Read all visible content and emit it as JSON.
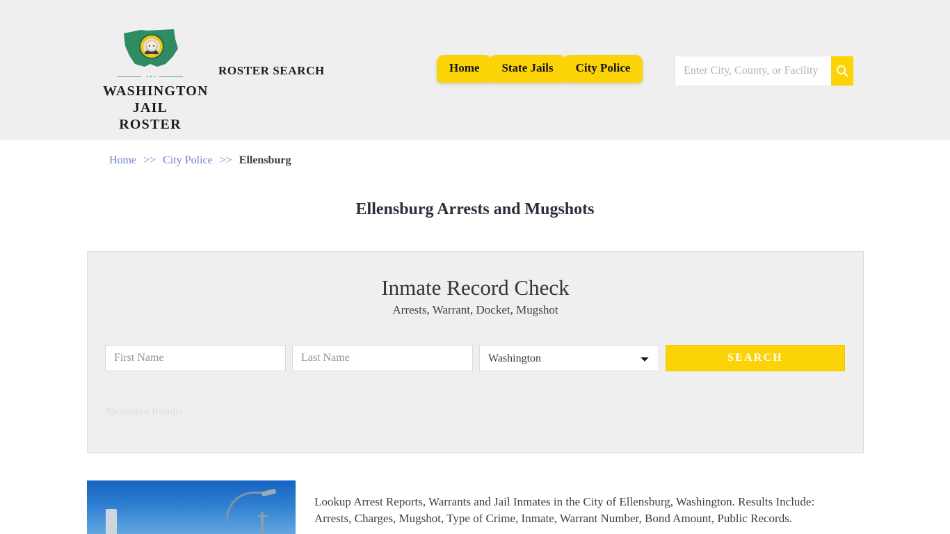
{
  "header": {
    "brand": {
      "line1": "WASHINGTON",
      "line2": "JAIL ROSTER",
      "mark_icon": "washington-state-seal-icon"
    },
    "roster_search_text": "ROSTER SEARCH",
    "nav": [
      {
        "label": "Home"
      },
      {
        "label": "State Jails"
      },
      {
        "label": "City Police"
      }
    ],
    "search": {
      "placeholder": "Enter City, County, or Facility",
      "value": "",
      "button_icon": "search-icon"
    },
    "background_color": "#efefef",
    "accent_color": "#fcd307"
  },
  "breadcrumb": {
    "items": [
      {
        "label": "Home",
        "link": true
      },
      {
        "label": "City Police",
        "link": true
      },
      {
        "label": "Ellensburg",
        "link": false
      }
    ],
    "separator": ">>",
    "link_color": "#6c7fd4"
  },
  "page": {
    "title": "Ellensburg Arrests and Mugshots"
  },
  "record_check": {
    "title": "Inmate Record Check",
    "subtitle": "Arrests, Warrant, Docket, Mugshot",
    "form": {
      "first_name_placeholder": "First Name",
      "first_name_value": "",
      "last_name_placeholder": "Last Name",
      "last_name_value": "",
      "state_selected": "Washington",
      "state_options": [
        "Washington"
      ],
      "submit_label": "SEARCH"
    },
    "sponsored_label": "Sponsored Results"
  },
  "article": {
    "photo_alt": "blue-sky-street-lamp-photo",
    "body": "Lookup Arrest Reports, Warrants and Jail Inmates in the City of Ellensburg, Washington. Results Include: Arrests, Charges, Mugshot, Type of Crime, Inmate, Warrant Number, Bond Amount, Public Records."
  }
}
